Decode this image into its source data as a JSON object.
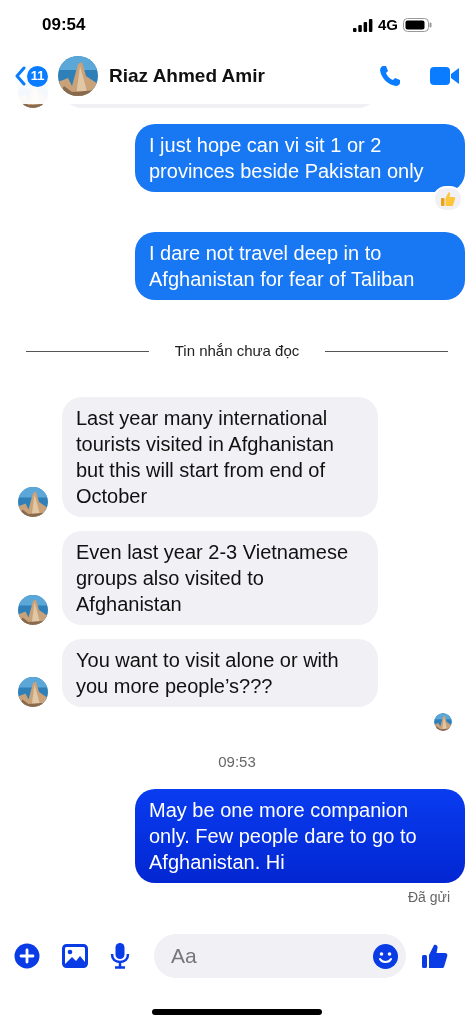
{
  "status_bar": {
    "time": "09:54",
    "network": "4G"
  },
  "header": {
    "back_badge": "11",
    "contact_name": "Riaz Ahmed Amir"
  },
  "messages": [
    {
      "kind": "incoming_cut"
    },
    {
      "kind": "outgoing",
      "text": "I just hope can vi sit 1 or 2 provinces beside Pakistan only",
      "reacted": true
    },
    {
      "kind": "outgoing",
      "text": "I dare not travel deep in to Afghanistan for fear of Taliban",
      "reacted": false
    },
    {
      "kind": "divider",
      "text": "Tin nhắn chưa đọc"
    },
    {
      "kind": "incoming",
      "text": "Last year many international tourists visited in Afghanistan but this will start from end of October"
    },
    {
      "kind": "incoming",
      "text": "Even last year 2-3  Vietnamese groups also visited to Afghanistan"
    },
    {
      "kind": "incoming",
      "text": "You want to visit alone or with you more people’s???"
    },
    {
      "kind": "seen"
    },
    {
      "kind": "time",
      "text": "09:53"
    },
    {
      "kind": "outgoing",
      "text": "May be one more companion only. Few people dare to go to Afghanistan. Hi",
      "reacted": false,
      "latest": true
    },
    {
      "kind": "status",
      "text": "Đã gửi"
    }
  ],
  "composer": {
    "placeholder": "Aa"
  }
}
